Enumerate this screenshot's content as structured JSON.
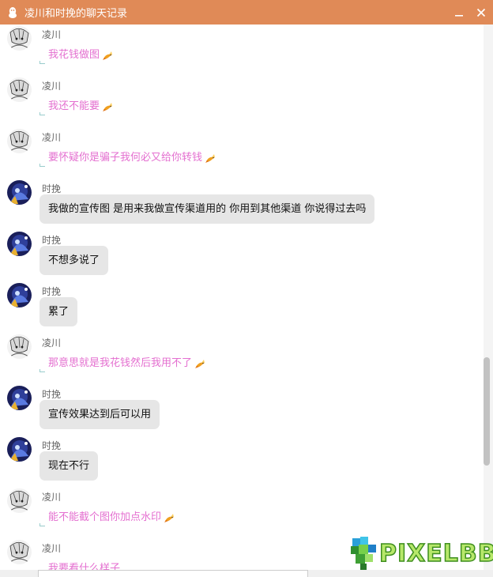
{
  "window": {
    "title": "凌川和时挽的聊天记录",
    "accent_color": "#e08a57",
    "icons": {
      "app": "qq-penguin-icon",
      "minimize": "minimize-icon",
      "close": "close-icon"
    }
  },
  "colors": {
    "pink_text": "#e46fd0",
    "bubble": "#e6e6e6"
  },
  "messages": [
    {
      "sender": "凌川",
      "style": "pink",
      "text": "我花钱做图",
      "emoji": "bird-emoji"
    },
    {
      "sender": "凌川",
      "style": "pink",
      "text": "我还不能要",
      "emoji": "bird-emoji"
    },
    {
      "sender": "凌川",
      "style": "pink",
      "text": "要怀疑你是骗子我何必又给你转钱",
      "emoji": "bird-emoji"
    },
    {
      "sender": "时挽",
      "style": "bubble",
      "text": "我做的宣传图 是用来我做宣传渠道用的 你用到其他渠道 你说得过去吗"
    },
    {
      "sender": "时挽",
      "style": "bubble",
      "text": "不想多说了"
    },
    {
      "sender": "时挽",
      "style": "bubble",
      "text": "累了"
    },
    {
      "sender": "凌川",
      "style": "pink",
      "text": "那意思就是我花钱然后我用不了",
      "emoji": "bird-emoji"
    },
    {
      "sender": "时挽",
      "style": "bubble",
      "text": "宣传效果达到后可以用"
    },
    {
      "sender": "时挽",
      "style": "bubble",
      "text": "现在不行"
    },
    {
      "sender": "凌川",
      "style": "pink",
      "text": "能不能截个图你加点水印",
      "emoji": "bird-emoji"
    },
    {
      "sender": "凌川",
      "style": "pink",
      "text": "我要看什么样子",
      "emoji": ""
    }
  ],
  "watermark": {
    "text": "PIXELBBS"
  }
}
